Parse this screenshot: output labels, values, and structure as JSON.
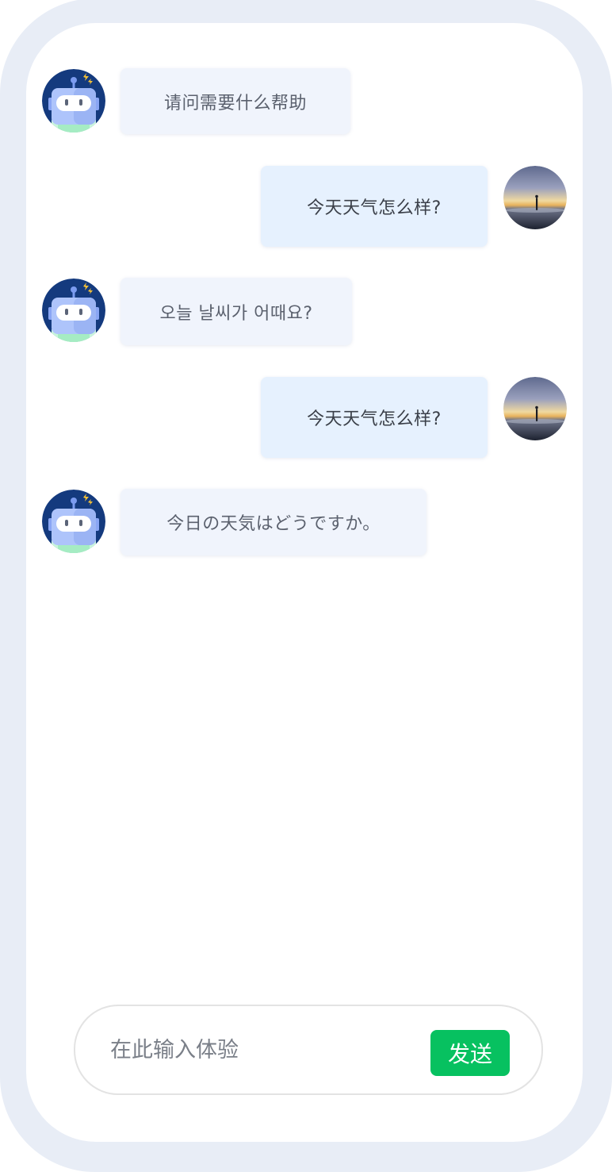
{
  "messages": [
    {
      "role": "bot",
      "text": "请问需要什么帮助"
    },
    {
      "role": "user",
      "text": "今天天气怎么样?"
    },
    {
      "role": "bot",
      "text": "오늘 날씨가 어때요?"
    },
    {
      "role": "user",
      "text": "今天天气怎么样?"
    },
    {
      "role": "bot",
      "text": "今日の天気はどうですか。"
    }
  ],
  "composer": {
    "placeholder": "在此输入体验",
    "send_label": "发送"
  },
  "colors": {
    "frame": "#e8edf6",
    "bot_bubble": "#f0f4fc",
    "user_bubble": "#e6f1fe",
    "send_button": "#07c160"
  },
  "icons": {
    "bot_avatar": "robot-avatar-icon",
    "user_avatar": "user-photo-avatar"
  }
}
